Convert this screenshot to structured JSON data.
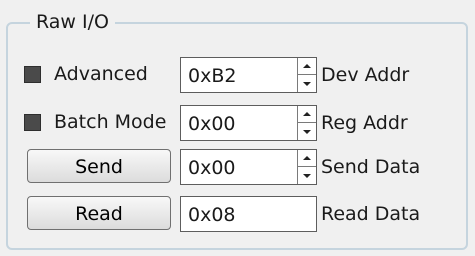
{
  "group": {
    "title": "Raw I/O"
  },
  "options": {
    "advanced_label": "Advanced",
    "batch_mode_label": "Batch Mode"
  },
  "buttons": {
    "send_label": "Send",
    "read_label": "Read"
  },
  "fields": {
    "dev_addr": {
      "value": "0xB2",
      "label": "Dev Addr"
    },
    "reg_addr": {
      "value": "0x00",
      "label": "Reg Addr"
    },
    "send_data": {
      "value": "0x00",
      "label": "Send Data"
    },
    "read_data": {
      "value": "0x08",
      "label": "Read Data"
    }
  },
  "icons": {
    "spin_up": "arrow-up-icon",
    "spin_down": "arrow-down-icon"
  },
  "colors": {
    "background": "#f0f0f0",
    "group_border": "#c5d4de",
    "checkbox_fill": "#4a4a4a"
  }
}
